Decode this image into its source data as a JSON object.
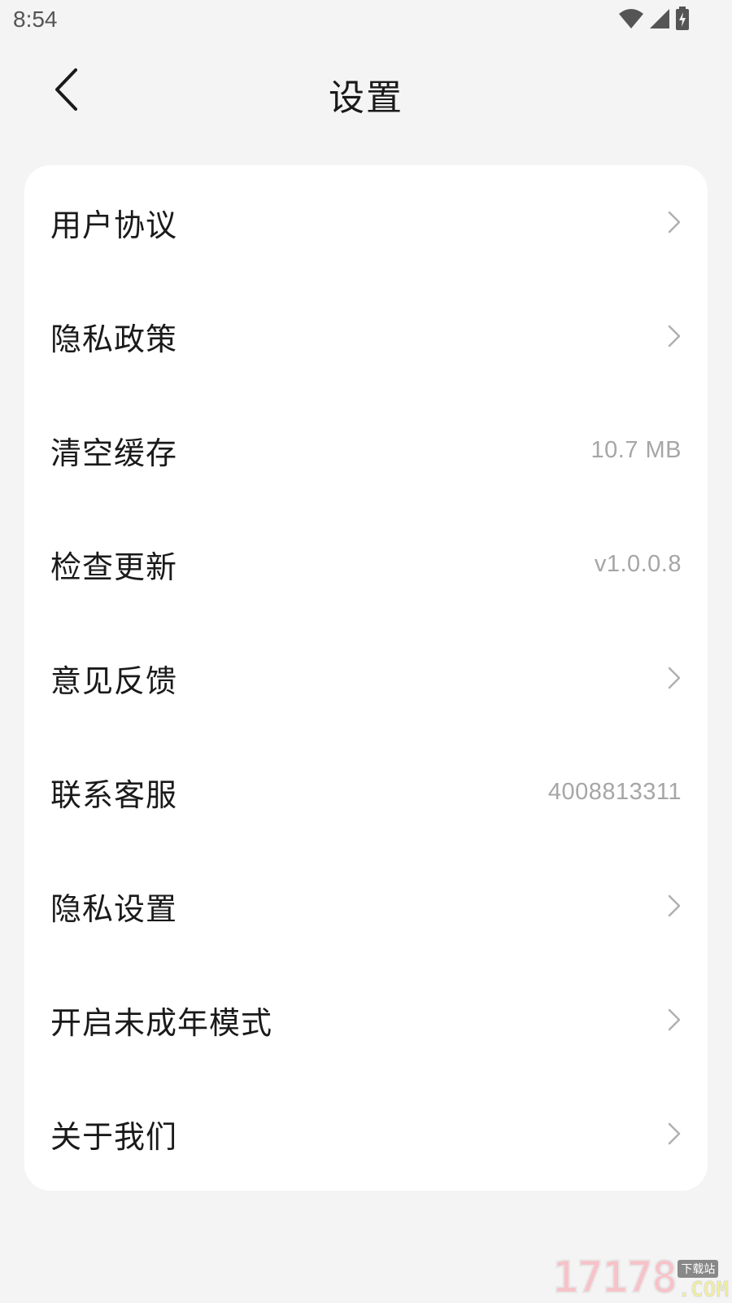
{
  "status_bar": {
    "time": "8:54",
    "icons": [
      "wifi-icon",
      "signal-icon",
      "battery-charging-icon"
    ]
  },
  "header": {
    "title": "设置",
    "back_icon": "chevron-left-icon"
  },
  "settings": {
    "items": [
      {
        "label": "用户协议",
        "value": null,
        "chevron": true
      },
      {
        "label": "隐私政策",
        "value": null,
        "chevron": true
      },
      {
        "label": "清空缓存",
        "value": "10.7 MB",
        "chevron": false
      },
      {
        "label": "检查更新",
        "value": "v1.0.0.8",
        "chevron": false
      },
      {
        "label": "意见反馈",
        "value": null,
        "chevron": true
      },
      {
        "label": "联系客服",
        "value": "4008813311",
        "chevron": false
      },
      {
        "label": "隐私设置",
        "value": null,
        "chevron": true
      },
      {
        "label": "开启未成年模式",
        "value": null,
        "chevron": true
      },
      {
        "label": "关于我们",
        "value": null,
        "chevron": true
      }
    ]
  },
  "watermark": {
    "number": "17178",
    "tag": "下载站",
    "suffix": ".COM"
  },
  "colors": {
    "background": "#f4f4f4",
    "card": "#ffffff",
    "text_primary": "#1a1a1a",
    "text_secondary": "#a6a6a6",
    "chevron": "#b0b0b0"
  }
}
